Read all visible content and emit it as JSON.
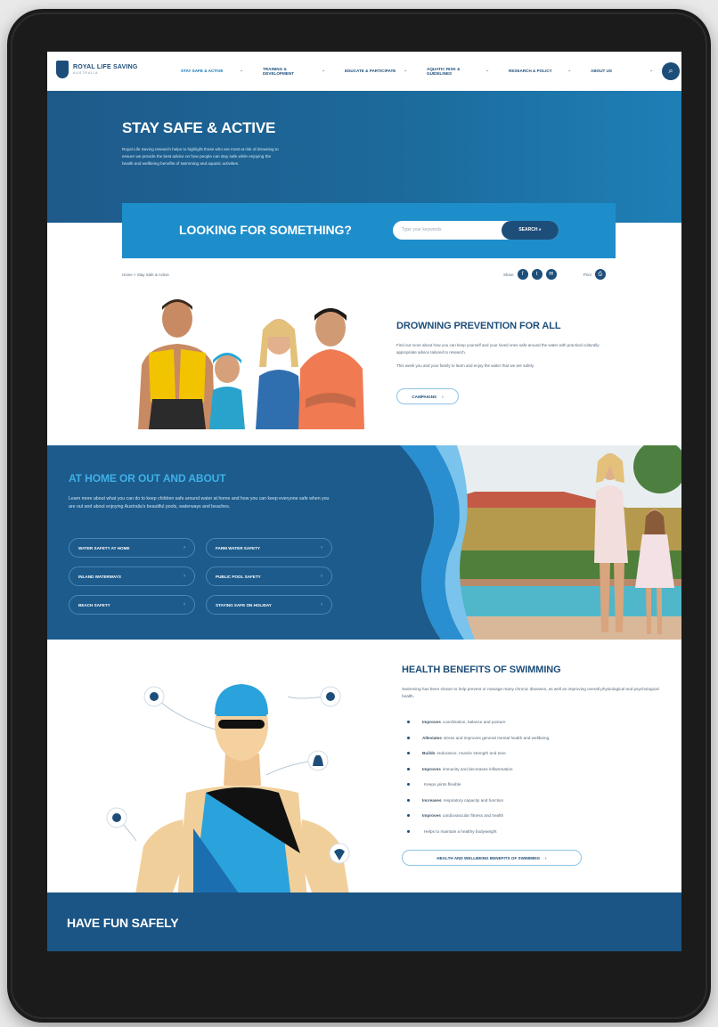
{
  "nav": {
    "logo": "ROYAL LIFE SAVING",
    "logo_sub": "AUSTRALIA",
    "items": [
      {
        "label": "STAY SAFE & ACTIVE"
      },
      {
        "label": "TRAINING & DEVELOPMENT"
      },
      {
        "label": "EDUCATE & PARTICIPATE"
      },
      {
        "label": "AQUATIC RISK & GUIDELINES"
      },
      {
        "label": "RESEARCH & POLICY"
      },
      {
        "label": "ABOUT US"
      }
    ],
    "search_icon": "search-icon"
  },
  "hero": {
    "title": "STAY SAFE & ACTIVE",
    "text": "Royal Life Saving research helps to highlight those who are most at risk of drowning to ensure we provide the best advice on how people can stay safe while enjoying the health and wellbeing benefits of swimming and aquatic activities."
  },
  "search": {
    "title": "LOOKING FOR SOMETHING?",
    "placeholder": "Type your keywords",
    "button": "SEARCH"
  },
  "breadcrumb": "Home > Stay Safe & Active",
  "share": {
    "label": "Share",
    "print": "Print"
  },
  "drowning": {
    "title": "DROWNING PREVENTION FOR ALL",
    "p1": "Find out more about how you can keep yourself and your loved ones safe around the water with practical culturally appropriate advice tailored to research.",
    "p2": "This week you and your family to learn and enjoy the water that we are safely.",
    "button": "CAMPAIGNS"
  },
  "home": {
    "title": "AT HOME OR OUT AND ABOUT",
    "text": "Learn more about what you can do to keep children safe around water at home and how you can keep everyone safe when you are out and about enjoying Australia's beautiful pools, waterways and beaches.",
    "buttons": [
      {
        "label": "WATER SAFETY AT HOME"
      },
      {
        "label": "FARM WATER SAFETY"
      },
      {
        "label": "INLAND WATERWAYS"
      },
      {
        "label": "PUBLIC POOL SAFETY"
      },
      {
        "label": "BEACH SAFETY"
      },
      {
        "label": "STAYING SAFE ON HOLIDAY"
      }
    ]
  },
  "health": {
    "title": "HEALTH BENEFITS OF SWIMMING",
    "intro": "Swimming has been shown to help prevent or manage many chronic diseases, as well as improving overall physiological and psychological health.",
    "items": [
      {
        "strong": "Improves",
        "text": "coordination, balance and posture"
      },
      {
        "strong": "Alleviates",
        "text": "stress and improves general mental health and wellbeing"
      },
      {
        "strong": "Builds",
        "text": "endurance, muscle strength and tone"
      },
      {
        "strong": "Improves",
        "text": "immunity and decreases inflammation"
      },
      {
        "strong": "",
        "text": "Keeps joints flexible"
      },
      {
        "strong": "Increases",
        "text": "respiratory capacity and function"
      },
      {
        "strong": "Improves",
        "text": "cardiovascular fitness and health"
      },
      {
        "strong": "",
        "text": "Helps to maintain a healthy bodyweight"
      }
    ],
    "button": "HEALTH AND WELLBEING BENEFITS OF SWIMMING"
  },
  "fun": {
    "title": "HAVE FUN SAFELY"
  },
  "colors": {
    "navy": "#1d4e7a",
    "hero": "#1e6a9b",
    "accent": "#1e8ecb",
    "light_accent": "#3fb0e6"
  }
}
